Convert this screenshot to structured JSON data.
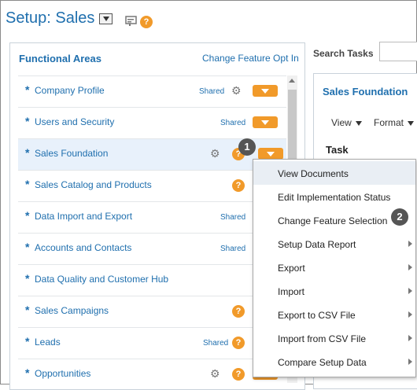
{
  "header": {
    "title": "Setup: Sales"
  },
  "functional_areas": {
    "title": "Functional Areas",
    "change_feature_opt_in": "Change Feature Opt In",
    "items": [
      {
        "label": "Company Profile",
        "shared": "Shared"
      },
      {
        "label": "Users and Security",
        "shared": "Shared"
      },
      {
        "label": "Sales Foundation",
        "shared": ""
      },
      {
        "label": "Sales Catalog and Products",
        "shared": ""
      },
      {
        "label": "Data Import and Export",
        "shared": "Shared"
      },
      {
        "label": "Accounts and Contacts",
        "shared": "Shared"
      },
      {
        "label": "Data Quality and Customer Hub",
        "shared": ""
      },
      {
        "label": "Sales Campaigns",
        "shared": ""
      },
      {
        "label": "Leads",
        "shared": "Shared"
      },
      {
        "label": "Opportunities",
        "shared": ""
      }
    ]
  },
  "search": {
    "label": "Search Tasks",
    "value": ""
  },
  "right_panel": {
    "title": "Sales Foundation",
    "view_label": "View",
    "format_label": "Format",
    "task_header": "Task"
  },
  "callouts": {
    "one": "1",
    "two": "2"
  },
  "help_glyph": "?",
  "context_menu": {
    "items": [
      {
        "label": "View Documents",
        "submenu": false,
        "highlighted": true
      },
      {
        "label": "Edit Implementation Status",
        "submenu": false
      },
      {
        "label": "Change Feature Selection",
        "submenu": false
      },
      {
        "label": "Setup Data Report",
        "submenu": true
      },
      {
        "label": "Export",
        "submenu": true
      },
      {
        "label": "Import",
        "submenu": true
      },
      {
        "label": "Export to CSV File",
        "submenu": true
      },
      {
        "label": "Import from CSV File",
        "submenu": true
      },
      {
        "label": "Compare Setup Data",
        "submenu": true
      }
    ]
  },
  "colors": {
    "accent": "#1f6fae",
    "orange": "#f19a2a",
    "callout": "#555555"
  }
}
